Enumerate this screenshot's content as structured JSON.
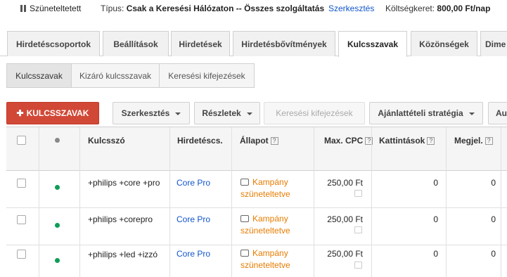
{
  "status_bar": {
    "state": "Szüneteltetett",
    "type_label": "Típus:",
    "type_value": "Csak a Keresési Hálózaton -- Összes szolgáltatás",
    "edit_link": "Szerkesztés",
    "budget_label": "Költségkeret:",
    "budget_value": "800,00 Ft/nap"
  },
  "tabs": [
    {
      "label": "Hirdetéscsoportok"
    },
    {
      "label": "Beállítások"
    },
    {
      "label": "Hirdetések"
    },
    {
      "label": "Hirdetésbővítmények"
    },
    {
      "label": "Kulcsszavak"
    },
    {
      "label": "Közönségek"
    },
    {
      "label": "Dime"
    }
  ],
  "subtabs": [
    {
      "label": "Kulcsszavak"
    },
    {
      "label": "Kizáró kulcsszavak"
    },
    {
      "label": "Keresési kifejezések"
    }
  ],
  "toolbar": {
    "add_keywords": "KULCSSZAVAK",
    "edit": "Szerkesztés",
    "details": "Részletek",
    "search_terms": "Keresési kifejezések",
    "bid_strategy": "Ajánlattételi stratégia",
    "more": "Au"
  },
  "table": {
    "columns": {
      "keyword": "Kulcsszó",
      "adgroup": "Hirdetéscs.",
      "status": "Állapot",
      "max_cpc": "Max. CPC",
      "clicks": "Kattintások",
      "impressions": "Megjel."
    },
    "help_glyph": "?",
    "rows": [
      {
        "keyword": "+philips +core +pro",
        "adgroup": "Core Pro",
        "status": "Kampány szüneteltetve",
        "max_cpc": "250,00 Ft",
        "clicks": "0",
        "impressions": "0"
      },
      {
        "keyword": "+philips +corepro",
        "adgroup": "Core Pro",
        "status": "Kampány szüneteltetve",
        "max_cpc": "250,00 Ft",
        "clicks": "0",
        "impressions": "0"
      },
      {
        "keyword": "+philips +led +izzó",
        "adgroup": "Core Pro",
        "status": "Kampány szüneteltetve",
        "max_cpc": "250,00 Ft",
        "clicks": "0",
        "impressions": "0"
      }
    ]
  },
  "colors": {
    "accent_red": "#d14836",
    "link_blue": "#1155cc",
    "status_orange": "#e67c00",
    "enabled_green": "#0f9d58"
  }
}
